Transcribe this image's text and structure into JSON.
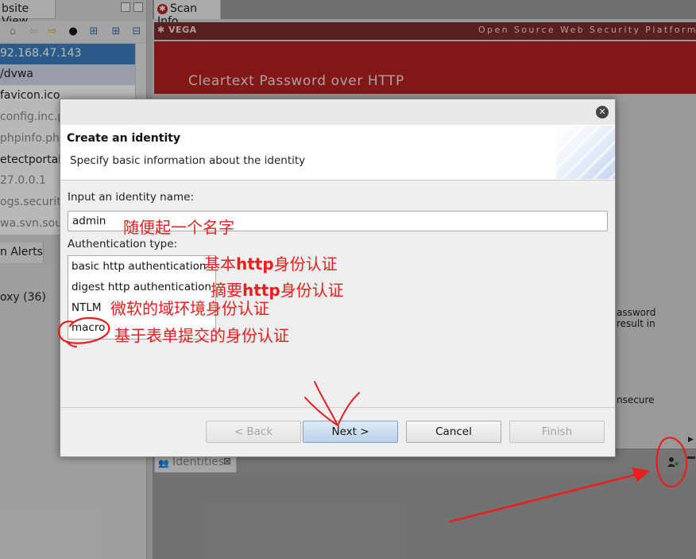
{
  "left_panel": {
    "tab_label": "bsite View",
    "tree_items": [
      {
        "label": "92.168.47.143",
        "state": "selected"
      },
      {
        "label": "/dvwa",
        "state": "highlight"
      },
      {
        "label": "favicon.ico",
        "state": "normal"
      },
      {
        "label": "config.inc.ph",
        "state": "dim"
      },
      {
        "label": "phpinfo.php",
        "state": "dim"
      },
      {
        "label": "etectportal.f",
        "state": "normal"
      },
      {
        "label": "27.0.0.1",
        "state": "dim"
      },
      {
        "label": "ogs.securit",
        "state": "dim"
      },
      {
        "label": "wa.svn.sou",
        "state": "dim"
      }
    ],
    "alerts_tab_label": "n Alerts",
    "alerts_row": "oxy (36)"
  },
  "scan_info": {
    "tab_label": "Scan Info",
    "logo_text": "VEGA",
    "tagline": "Open Source Web Security Platform",
    "alert_title": "Cleartext Password over HTTP",
    "bg_text": [
      "assword",
      "result in",
      "nsecure"
    ]
  },
  "identities": {
    "tab_label": "Identities"
  },
  "dialog": {
    "title": "Create an identity",
    "subtitle": "Specify basic information about the identity",
    "name_label": "Input an identity name:",
    "name_value": "admin",
    "auth_label": "Authentication type:",
    "auth_types": [
      "basic http authentication",
      "digest http authentication",
      "NTLM",
      "macro"
    ],
    "buttons": {
      "back": "< Back",
      "next": "Next >",
      "cancel": "Cancel",
      "finish": "Finish"
    }
  },
  "annotations": {
    "name_note": "随便起一个名字",
    "basic_note_pre": "基本",
    "basic_note_bold": "http",
    "basic_note_post": "身份认证",
    "digest_note_pre": "摘要",
    "digest_note_bold": "http",
    "digest_note_post": "身份认证",
    "ntlm_note": "微软的域环境身份认证",
    "macro_note": "基于表单提交的身份认证",
    "color": "#ee1c1c"
  }
}
